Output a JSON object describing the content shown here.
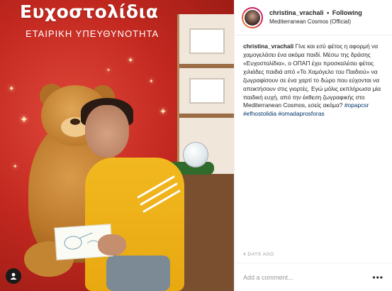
{
  "photo": {
    "banner_title": "Ευχοστολίδια",
    "banner_subtitle": "ΕΤΑΙΡΙΚΗ ΥΠΕΥΘΥΝΟΤΗΤΑ",
    "user_badge_icon": "user-icon"
  },
  "header": {
    "username": "christina_vrachali",
    "separator": "•",
    "follow_label": "Following",
    "location": "Mediterranean Cosmos (Official)"
  },
  "caption": {
    "username": "christina_vrachali",
    "text": "Γίνε και εσύ φέτος η αφορμή να χαμογελάσει ένα ακόμα παιδί. Μέσω της δράσης «Ευχοστολίδια», ο ΟΠΑΠ έχει προσκαλέσει φέτος χιλιάδες παιδιά από «Το Χαμόγελο του Παιδιού» να ζωγραφίσουν σε ένα χαρτί το δώρο που εύχονται να αποκτήσουν στις γιορτές. Εγώ μόλις εκπλήρωσα μία παιδική ευχή, από την έκθεση ζωγραφικής στο Mediterranean Cosmos, εσείς ακόμα?",
    "hashtags": [
      "#opapcsr",
      "#efhostolidia",
      "#omadaprosforas"
    ]
  },
  "timestamp": "4 DAYS AGO",
  "comment": {
    "placeholder": "Add a comment...",
    "more_icon": "more-icon"
  },
  "colors": {
    "hashtag": "#003569",
    "banner_red": "#c2281f",
    "sweater_yellow": "#f2b820"
  }
}
